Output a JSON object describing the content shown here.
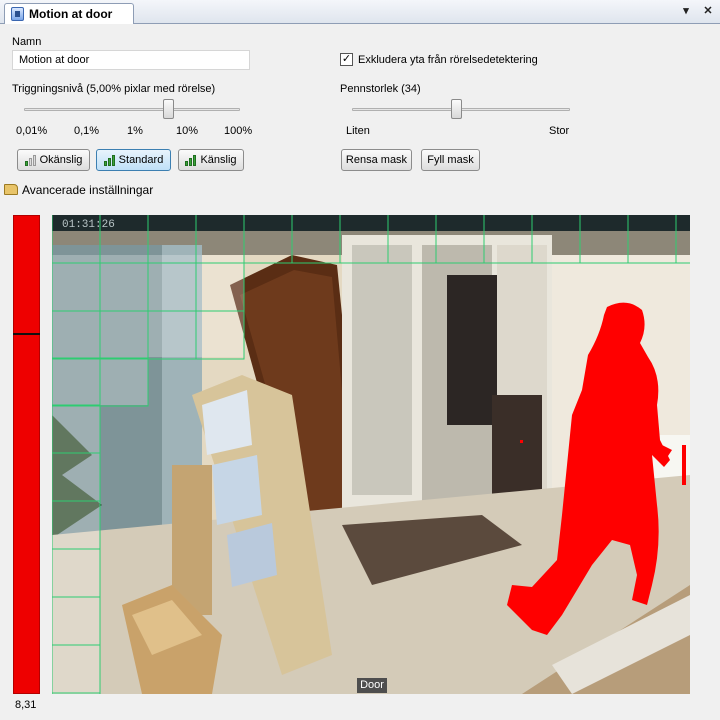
{
  "tab": {
    "title": "Motion at door",
    "pin_glyph": "▾",
    "close_glyph": "✕"
  },
  "settings": {
    "name_label": "Namn",
    "name_value": "Motion at door",
    "trigger_label": "Triggningsnivå (5,00% pixlar med rörelse)",
    "trigger_ticks": [
      "0,01%",
      "0,1%",
      "1%",
      "10%",
      "100%"
    ],
    "trigger_level_fraction": 0.68,
    "sensitivity_buttons": [
      "Okänslig",
      "Standard",
      "Känslig"
    ],
    "exclude_checkbox_label": "Exkludera yta från rörelsedetektering",
    "exclude_checked": true,
    "checkmark_glyph": "✓",
    "pen_size_label": "Pennstorlek (34)",
    "pen_size_fraction": 0.48,
    "pen_min_label": "Liten",
    "pen_max_label": "Stor",
    "clear_mask_button": "Rensa mask",
    "fill_mask_button": "Fyll mask",
    "advanced_label": "Avancerade inställningar"
  },
  "camera": {
    "timestamp": "01:31:26",
    "view_label": "Door",
    "level_value": "8,31",
    "motion_color": "#ff0000",
    "grid_color": "#2ecc71"
  }
}
